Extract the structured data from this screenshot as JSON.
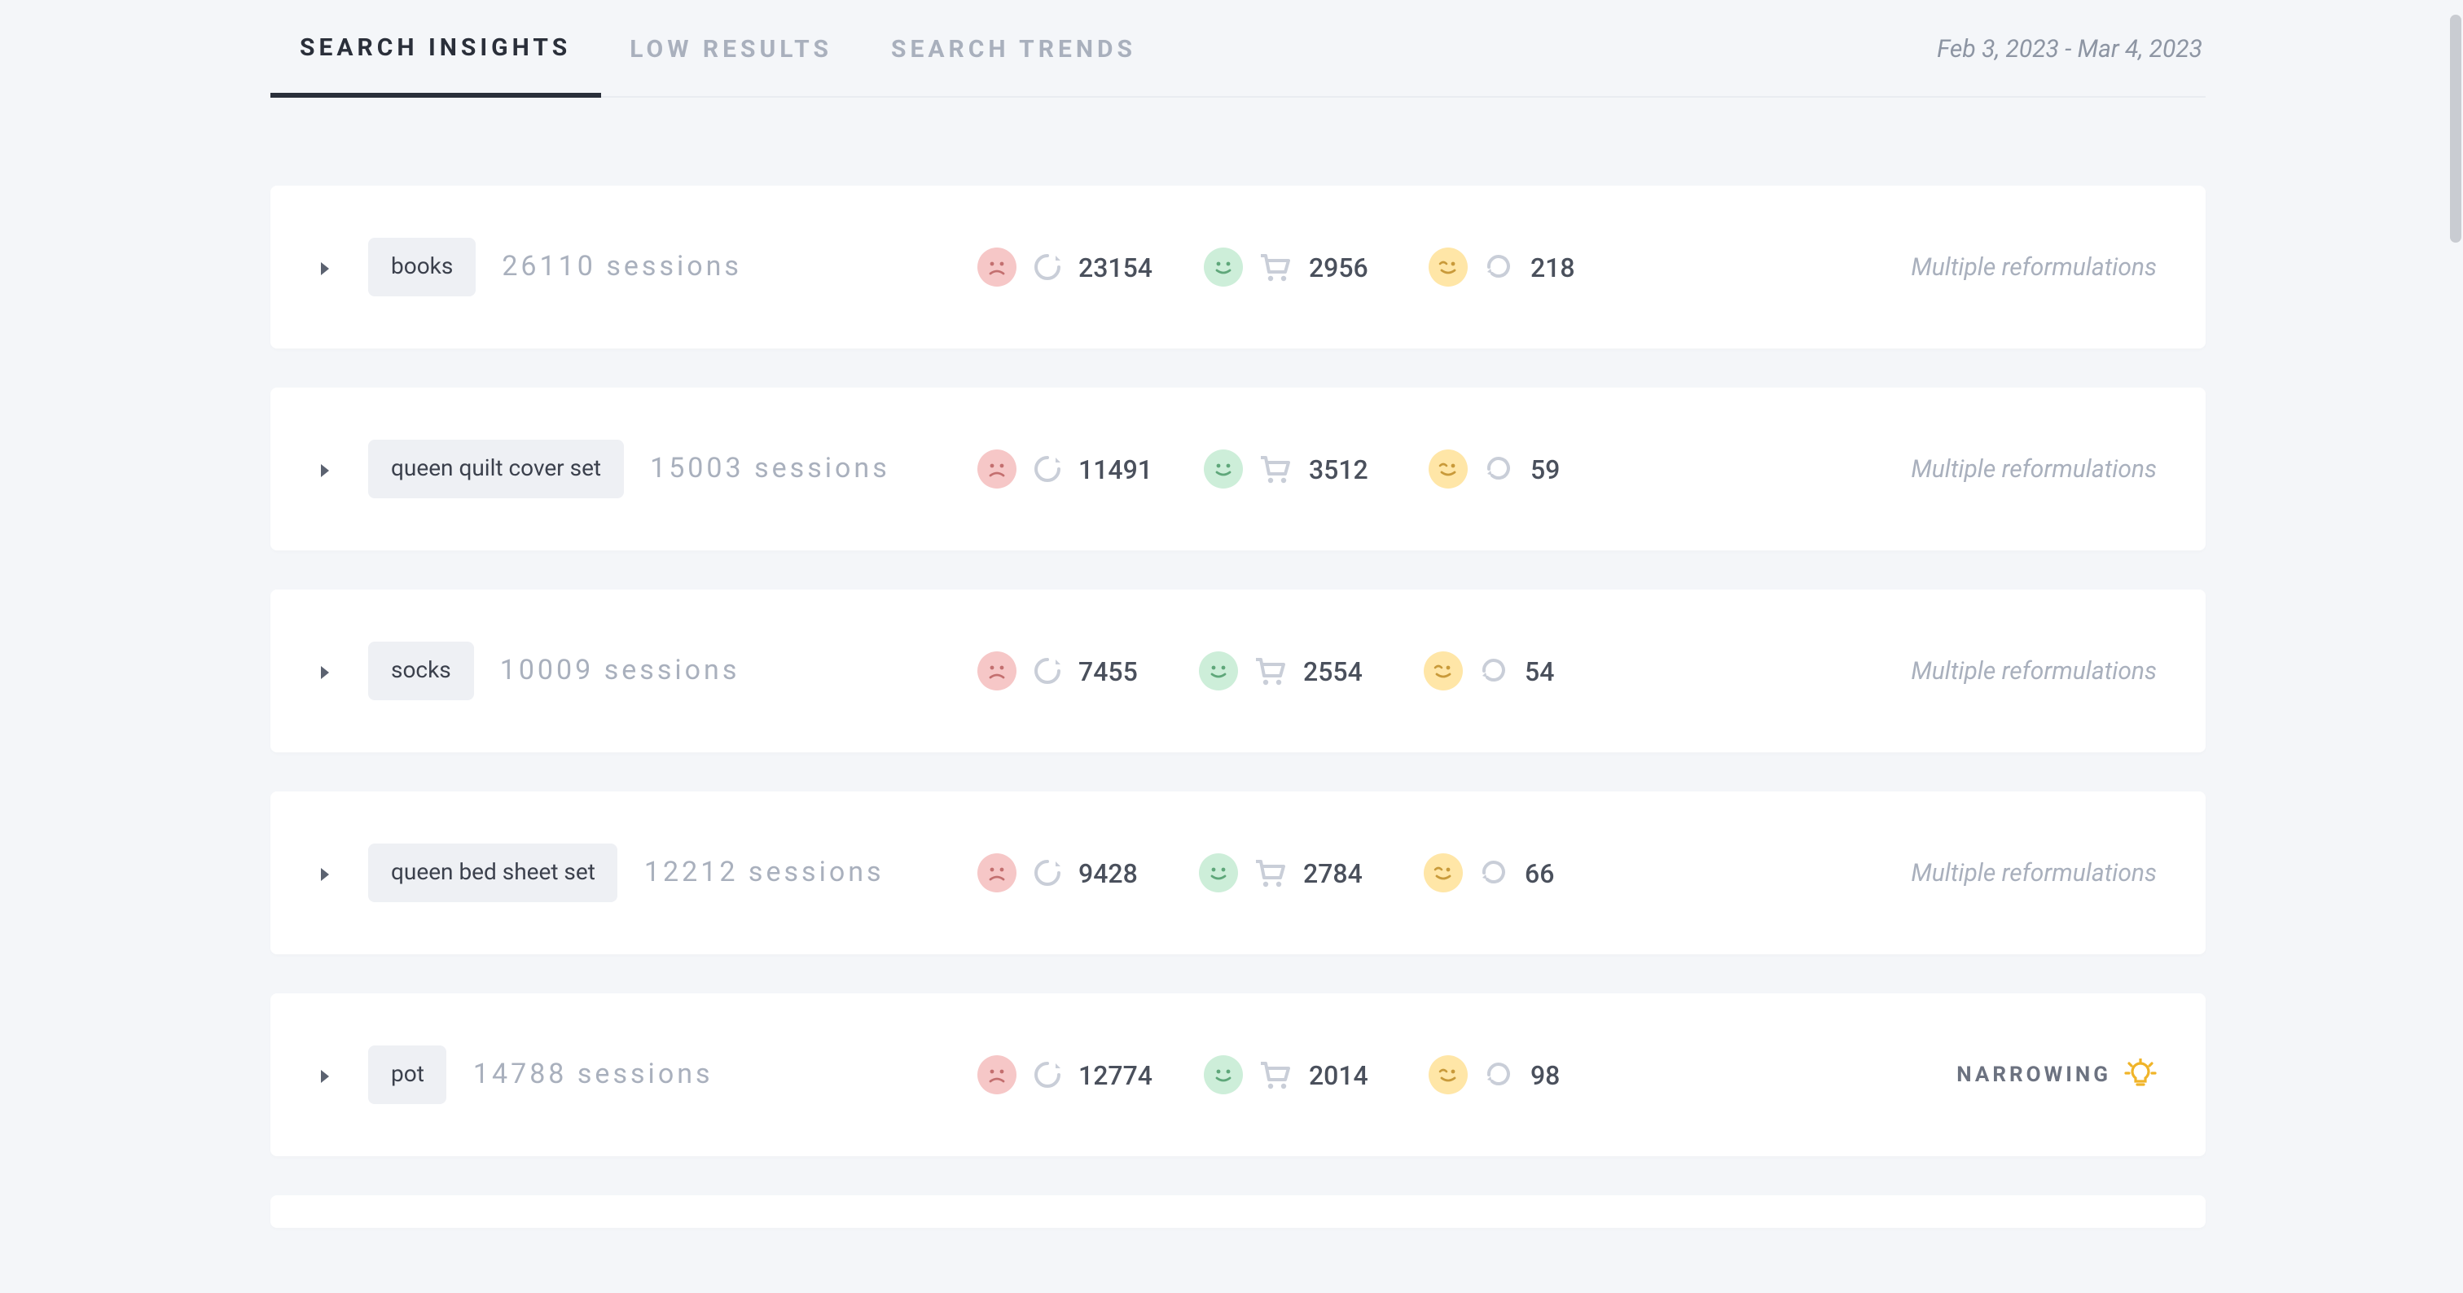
{
  "tabs": {
    "insights": "Search Insights",
    "low": "Low Results",
    "trends": "Search Trends"
  },
  "date_range": "Feb 3, 2023 - Mar 4, 2023",
  "sessions_label": "sessions",
  "notes": {
    "multiple": "Multiple reformulations",
    "narrowing": "Narrowing"
  },
  "rows": [
    {
      "query": "books",
      "sessions": "26110",
      "sad": "23154",
      "happy": "2956",
      "wink": "218",
      "note_key": "multiple"
    },
    {
      "query": "queen quilt cover set",
      "sessions": "15003",
      "sad": "11491",
      "happy": "3512",
      "wink": "59",
      "note_key": "multiple"
    },
    {
      "query": "socks",
      "sessions": "10009",
      "sad": "7455",
      "happy": "2554",
      "wink": "54",
      "note_key": "multiple"
    },
    {
      "query": "queen bed sheet set",
      "sessions": "12212",
      "sad": "9428",
      "happy": "2784",
      "wink": "66",
      "note_key": "multiple"
    },
    {
      "query": "pot",
      "sessions": "14788",
      "sad": "12774",
      "happy": "2014",
      "wink": "98",
      "note_key": "narrowing"
    }
  ]
}
